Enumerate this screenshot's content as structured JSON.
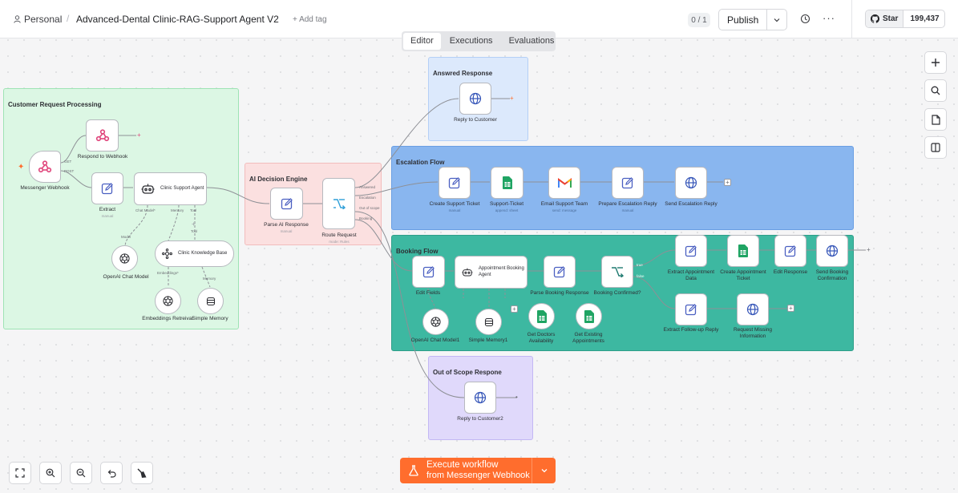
{
  "header": {
    "workspace": "Personal",
    "separator": "/",
    "workflow_name": "Advanced-Dental Clinic-RAG-Support Agent V2",
    "add_tag": "+ Add tag",
    "counter": "0 / 1",
    "publish": "Publish",
    "github_star": "Star",
    "github_count": "199,437"
  },
  "tabs": [
    "Editor",
    "Executions",
    "Evaluations"
  ],
  "groups": {
    "customer": "Customer Request Processing",
    "decision": "AI Decision Engine",
    "answered": "Answred Response",
    "escalation": "Escalation Flow",
    "booking": "Booking Flow",
    "scope": "Out of Scope Respone"
  },
  "nodes": {
    "messenger_webhook": "Messenger Webhook",
    "respond_webhook": "Respond to Webhook",
    "extract": "Extract",
    "extract_sub": "manual",
    "clinic_agent": "Clinic Support Agent",
    "openai_chat": "OpenAI Chat Model",
    "knowledge_base": "Clinic Knowledge Base",
    "embeddings": "Embeddings Retreival",
    "simple_memory": "Simple Memory",
    "parse_ai": "Parse AI Response",
    "parse_ai_sub": "manual",
    "route_request": "Route Request",
    "route_request_sub": "mode: Rules",
    "reply_customer": "Reply to Customer",
    "create_ticket": "Create Support Ticket",
    "create_ticket_sub": "manual",
    "support_ticket": "Support-Ticket",
    "support_ticket_sub": "append: sheet",
    "email_team": "Email Support Team",
    "email_team_sub": "send: message",
    "prepare_reply": "Prepare Escalation Reply",
    "prepare_reply_sub": "manual",
    "send_escalation": "Send Escalation Reply",
    "edit_fields": "Edit Fields",
    "appointment_agent": "Appointment Booking Agent",
    "parse_booking": "Parse Booking Response",
    "booking_confirmed": "Booking Confirmed?",
    "extract_appt": "Extract Appointment Data",
    "create_appt_ticket": "Create Appointment Ticket",
    "edit_response": "Edit Response",
    "send_booking": "Send Booking Confirmation",
    "extract_followup": "Extract Follow-up Reply",
    "request_missing": "Request Missing Information",
    "openai_chat1": "OpenAI Chat Model1",
    "simple_memory1": "Simple Memory1",
    "get_doctors": "Get Doctors Availability",
    "get_appointments": "Get Existing Appointments",
    "reply_customer2": "Reply to Customer2"
  },
  "ports": {
    "get": "GET",
    "post": "POST",
    "chat_model": "Chat Model*",
    "memory": "Memory",
    "tool": "Tool",
    "tool2": "Tool",
    "model": "Model",
    "embeddings": "Embeddings*",
    "memory2": "Memory",
    "answered": "Answered",
    "escalation": "Escalation",
    "out_of_scope": "Out of scope",
    "booking": "Booking",
    "true": "true",
    "false": "false"
  },
  "execute": {
    "title": "Execute workflow",
    "subtitle": "from Messenger Webhook"
  },
  "colors": {
    "accent": "#ff6d2d",
    "customer_group": "#dcf7e4",
    "decision_group": "#fbe0e0",
    "answered_group": "#dce9fc",
    "escalation_group": "#89b6ef",
    "booking_group": "#3db8a1",
    "scope_group": "#e0d9fb"
  },
  "icons": {
    "edit": "pencil-square-icon",
    "webhook": "webhook-icon",
    "http": "globe-icon",
    "sheets": "google-sheets-icon",
    "gmail": "gmail-icon",
    "switch": "switch-icon",
    "openai": "openai-icon",
    "memory": "database-icon",
    "agent": "robot-icon"
  }
}
